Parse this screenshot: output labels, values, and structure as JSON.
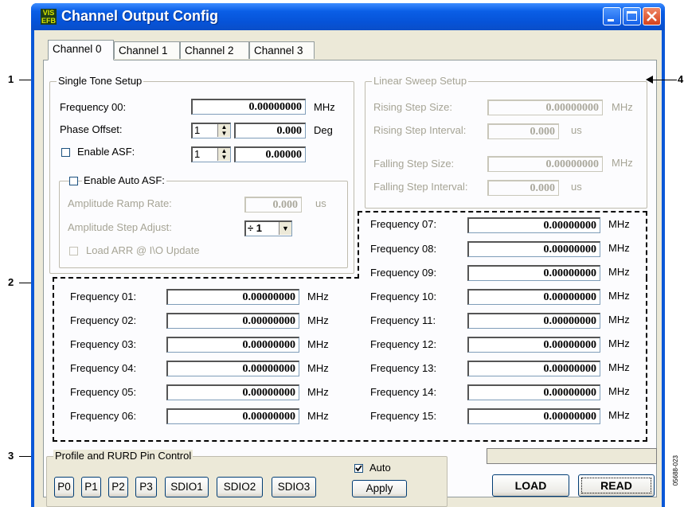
{
  "window": {
    "title": "Channel Output Config",
    "icon_text": "VIS EFB"
  },
  "tabs": [
    {
      "label": "Channel 0",
      "active": true
    },
    {
      "label": "Channel 1",
      "active": false
    },
    {
      "label": "Channel 2",
      "active": false
    },
    {
      "label": "Channel 3",
      "active": false
    }
  ],
  "single_tone": {
    "legend": "Single Tone Setup",
    "freq00_label": "Frequency 00:",
    "freq00_value": "0.00000000",
    "freq00_unit": "MHz",
    "phase_label": "Phase Offset:",
    "phase_step": "1",
    "phase_value": "0.000",
    "phase_unit": "Deg",
    "asf_label": "Enable ASF:",
    "asf_step": "1",
    "asf_value": "0.00000",
    "auto_asf": {
      "legend": "Enable Auto ASF:",
      "ramp_label": "Amplitude Ramp Rate:",
      "ramp_value": "0.000",
      "ramp_unit": "us",
      "step_label": "Amplitude Step Adjust:",
      "step_value": "÷ 1",
      "load_label": "Load ARR @ I\\O Update"
    }
  },
  "linear_sweep": {
    "legend": "Linear Sweep Setup",
    "rising_size_label": "Rising Step Size:",
    "rising_size_value": "0.00000000",
    "rising_size_unit": "MHz",
    "rising_interval_label": "Rising Step Interval:",
    "rising_interval_value": "0.000",
    "rising_interval_unit": "us",
    "falling_size_label": "Falling Step Size:",
    "falling_size_value": "0.00000000",
    "falling_size_unit": "MHz",
    "falling_interval_label": "Falling Step Interval:",
    "falling_interval_value": "0.000",
    "falling_interval_unit": "us"
  },
  "freq_left": [
    {
      "label": "Frequency 01:",
      "value": "0.00000000",
      "unit": "MHz"
    },
    {
      "label": "Frequency 02:",
      "value": "0.00000000",
      "unit": "MHz"
    },
    {
      "label": "Frequency 03:",
      "value": "0.00000000",
      "unit": "MHz"
    },
    {
      "label": "Frequency 04:",
      "value": "0.00000000",
      "unit": "MHz"
    },
    {
      "label": "Frequency 05:",
      "value": "0.00000000",
      "unit": "MHz"
    },
    {
      "label": "Frequency 06:",
      "value": "0.00000000",
      "unit": "MHz"
    }
  ],
  "freq_right": [
    {
      "label": "Frequency 07:",
      "value": "0.00000000",
      "unit": "MHz"
    },
    {
      "label": "Frequency 08:",
      "value": "0.00000000",
      "unit": "MHz"
    },
    {
      "label": "Frequency 09:",
      "value": "0.00000000",
      "unit": "MHz"
    },
    {
      "label": "Frequency 10:",
      "value": "0.00000000",
      "unit": "MHz"
    },
    {
      "label": "Frequency 11:",
      "value": "0.00000000",
      "unit": "MHz"
    },
    {
      "label": "Frequency 12:",
      "value": "0.00000000",
      "unit": "MHz"
    },
    {
      "label": "Frequency 13:",
      "value": "0.00000000",
      "unit": "MHz"
    },
    {
      "label": "Frequency 14:",
      "value": "0.00000000",
      "unit": "MHz"
    },
    {
      "label": "Frequency 15:",
      "value": "0.00000000",
      "unit": "MHz"
    }
  ],
  "profile": {
    "legend": "Profile and RURD Pin Control",
    "buttons": [
      "P0",
      "P1",
      "P2",
      "P3",
      "SDIO1",
      "SDIO2",
      "SDIO3"
    ],
    "auto_label": "Auto",
    "auto_checked": true,
    "apply_label": "Apply"
  },
  "actions": {
    "load_label": "LOAD",
    "read_label": "READ"
  },
  "callouts": [
    "1",
    "2",
    "3",
    "4"
  ],
  "figure_code": "05688-023"
}
